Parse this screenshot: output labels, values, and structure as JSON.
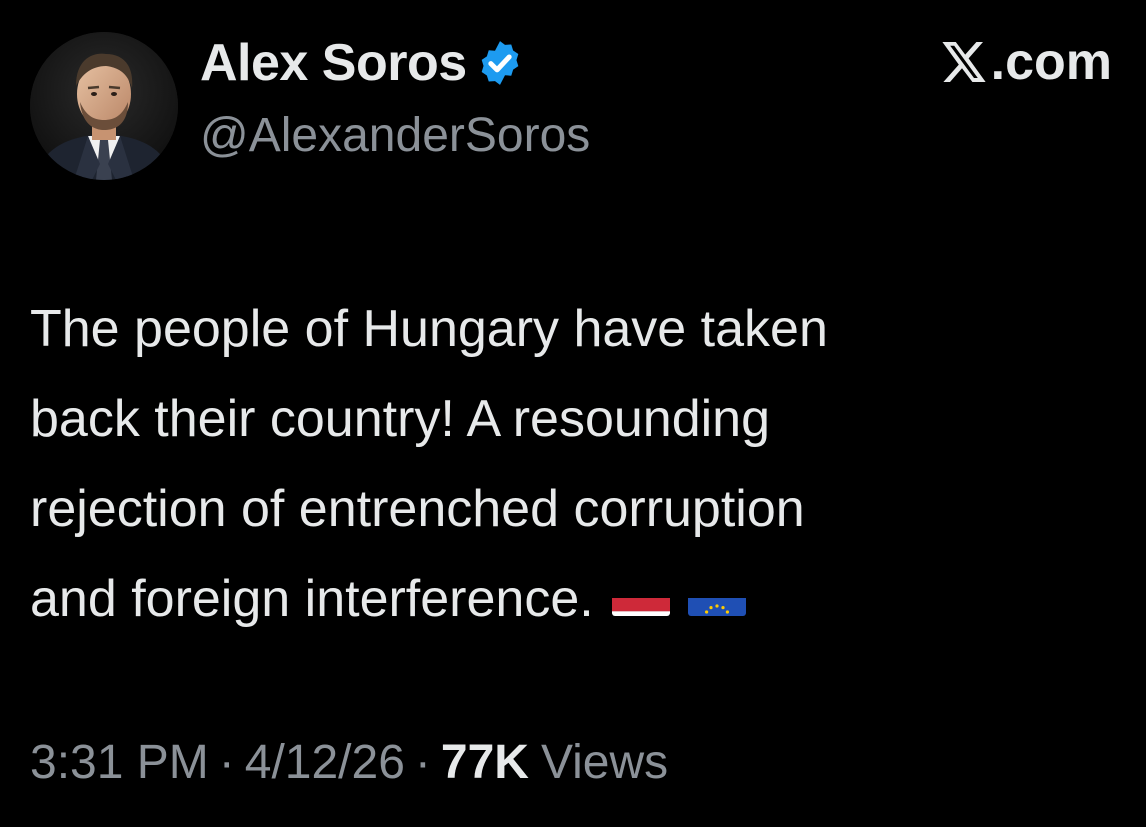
{
  "author": {
    "display_name": "Alex Soros",
    "handle": "@AlexanderSoros",
    "verified_icon": "verified-badge-icon",
    "avatar_icon": "profile-photo"
  },
  "brand": {
    "label": ".com",
    "logo_icon": "x-logo-icon"
  },
  "tweet": {
    "lines": [
      "The people of Hungary have taken",
      "back their country! A resounding",
      "rejection of entrenched corruption",
      "and foreign interference."
    ],
    "emojis": [
      "hungary-flag-icon",
      "eu-flag-icon"
    ]
  },
  "meta": {
    "time": "3:31 PM",
    "separator": "·",
    "date": "4/12/26",
    "views_count": "77K",
    "views_label": "Views"
  },
  "colors": {
    "background": "#000000",
    "primary_text": "#e7e9ea",
    "secondary_text": "#8b9198",
    "verified_blue": "#1d9bf0"
  }
}
